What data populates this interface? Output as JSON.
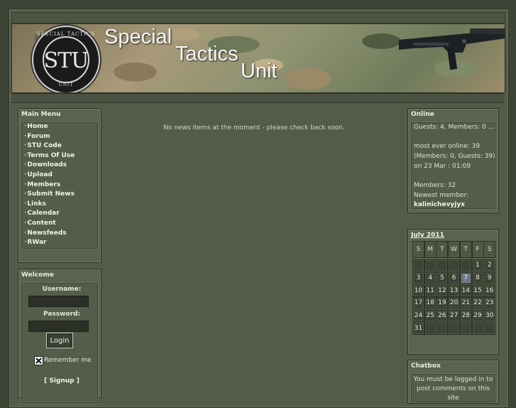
{
  "site": {
    "title_line1": "Special",
    "title_line2": "Tactics",
    "title_line3": "Unit",
    "logo_text": "STU",
    "logo_ring_top": "SPECIAL TACTICS",
    "logo_ring_bottom": "UNIT"
  },
  "main_menu": {
    "title": "Main Menu",
    "items": [
      "Home",
      "Forum",
      "STU Code",
      "Terms Of Use",
      "Downloads",
      "Upload",
      "Members",
      "Submit News",
      "Links",
      "Calendar",
      "Content",
      "Newsfeeds",
      "RWar"
    ]
  },
  "welcome": {
    "title": "Welcome",
    "username_label": "Username:",
    "password_label": "Password:",
    "login_label": "Login",
    "remember_label": "Remember me",
    "remember_checked": true,
    "signup_label": "[ Signup ]"
  },
  "news": {
    "message": "No news items at the moment - please check back soon."
  },
  "online": {
    "title": "Online",
    "guests_members": "Guests: 4, Members: 0 ...",
    "most_ever_1": "most ever online: 39",
    "most_ever_2": "(Members: 0, Guests: 39)",
    "most_ever_3": "on 23 Mar : 01:09",
    "members_count": "Members: 32",
    "newest_label": "Newest member:",
    "newest_name": "kalinichevyjyx"
  },
  "calendar": {
    "title": "July 2011",
    "weekdays": [
      "S",
      "M",
      "T",
      "W",
      "T",
      "F",
      "S"
    ],
    "days": [
      "",
      "",
      "",
      "",
      "",
      "1",
      "2",
      "3",
      "4",
      "5",
      "6",
      "7",
      "8",
      "9",
      "10",
      "11",
      "12",
      "13",
      "14",
      "15",
      "16",
      "17",
      "18",
      "19",
      "20",
      "21",
      "22",
      "23",
      "24",
      "25",
      "26",
      "27",
      "28",
      "29",
      "30",
      "31",
      "",
      "",
      "",
      "",
      "",
      ""
    ],
    "today": "7"
  },
  "chatbox": {
    "title": "Chatbox",
    "message": "You must be logged in to post comments on this site"
  },
  "colors": {
    "background": "#3e4536",
    "panel": "#5b6350",
    "today": "#6b7a86"
  }
}
